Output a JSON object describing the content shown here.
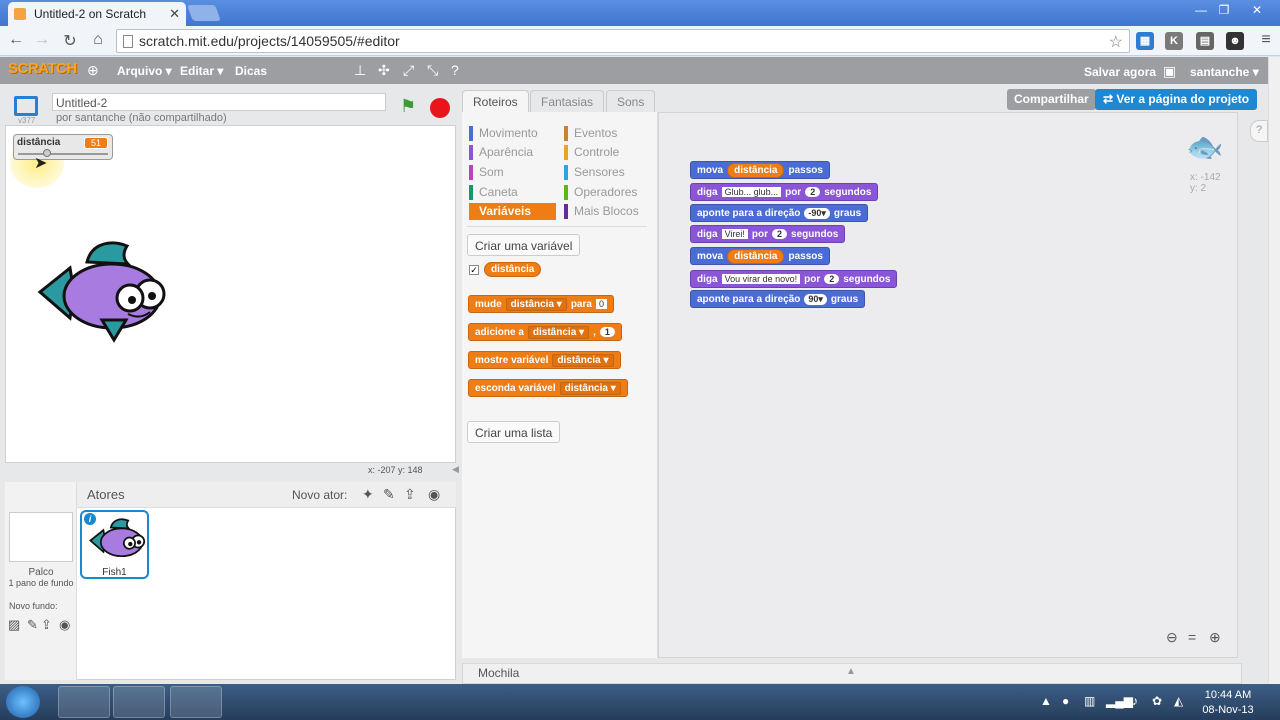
{
  "browser": {
    "tab_title": "Untitled-2 on Scratch",
    "url": "scratch.mit.edu/projects/14059505/#editor"
  },
  "menubar": {
    "logo": "SCRATCH",
    "file": "Arquivo ▾",
    "edit": "Editar ▾",
    "tips": "Dicas",
    "save_now": "Salvar agora",
    "username": "santanche ▾"
  },
  "stage": {
    "project_title": "Untitled-2",
    "byline": "por santanche (não compartilhado)",
    "version": "v377",
    "coords": "x: -207   y: 148",
    "monitor": {
      "label": "distância",
      "value": "51",
      "slider_fraction": 0.3
    }
  },
  "sprites": {
    "header": "Atores",
    "new_sprite": "Novo ator:",
    "stage_label": "Palco",
    "stage_backdrops": "1 pano de fundo",
    "new_backdrop": "Novo fundo:",
    "selected_sprite": "Fish1"
  },
  "tabs": {
    "scripts": "Roteiros",
    "costumes": "Fantasias",
    "sounds": "Sons"
  },
  "actions": {
    "share": "Compartilhar",
    "see_project": "Ver a página do projeto"
  },
  "categories": [
    {
      "label": "Movimento",
      "color": "#4a6cd4"
    },
    {
      "label": "Aparência",
      "color": "#8a55d7"
    },
    {
      "label": "Som",
      "color": "#bb42c3"
    },
    {
      "label": "Caneta",
      "color": "#0e9a6c"
    },
    {
      "label": "Variáveis",
      "color": "#ee7d16"
    },
    {
      "label": "Eventos",
      "color": "#c88330"
    },
    {
      "label": "Controle",
      "color": "#e1a91a"
    },
    {
      "label": "Sensores",
      "color": "#2ca5e2"
    },
    {
      "label": "Operadores",
      "color": "#5cb712"
    },
    {
      "label": "Mais Blocos",
      "color": "#632d99"
    }
  ],
  "palette": {
    "make_variable": "Criar uma variável",
    "variable_name": "distância",
    "set_block": {
      "a": "mude",
      "var": "distância ▾",
      "b": "para",
      "val": "0"
    },
    "change_block": {
      "a": "adicione a",
      "var": "distância ▾",
      "b": ",",
      "val": "1"
    },
    "show_block": {
      "a": "mostre variável",
      "var": "distância ▾"
    },
    "hide_block": {
      "a": "esconda variável",
      "var": "distância ▾"
    },
    "make_list": "Criar uma lista"
  },
  "script": [
    {
      "type": "blue",
      "parts": [
        "mova",
        "@distância",
        "passos"
      ]
    },
    {
      "type": "purple",
      "parts": [
        "diga",
        "#Glub... glub...",
        "por",
        "$2",
        "segundos"
      ]
    },
    {
      "type": "blue",
      "parts": [
        "aponte para a direção",
        "%-90▾",
        "graus"
      ]
    },
    {
      "type": "purple",
      "parts": [
        "diga",
        "#Virei!",
        "por",
        "$2",
        "segundos"
      ]
    },
    {
      "type": "blue",
      "parts": [
        "mova",
        "@distância",
        "passos"
      ]
    },
    {
      "type": "purple",
      "parts": [
        "diga",
        "#Vou virar de novo!",
        "por",
        "$2",
        "segundos"
      ]
    },
    {
      "type": "blue",
      "parts": [
        "aponte para a direção",
        "%90▾",
        "graus"
      ]
    }
  ],
  "script_sprite_xy": {
    "x": "x: -142",
    "y": "y: 2"
  },
  "backpack": "Mochila",
  "taskbar": {
    "time": "10:44 AM",
    "date": "08-Nov-13"
  }
}
